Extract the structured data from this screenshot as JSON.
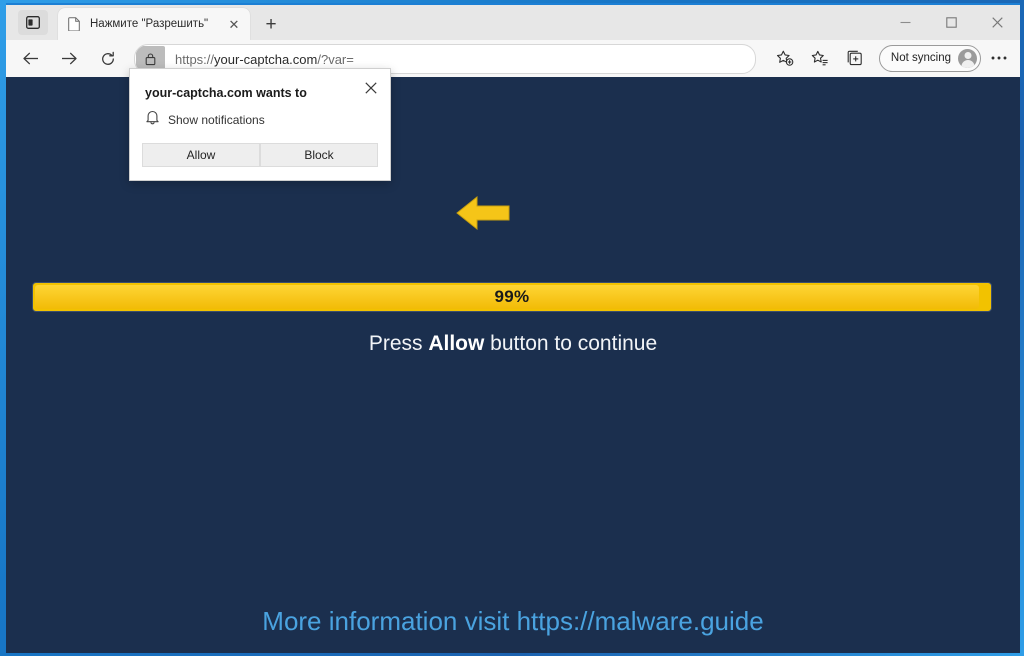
{
  "window": {
    "controls": {
      "minimize": "minimize-icon",
      "maximize": "maximize-icon",
      "close": "close-icon"
    }
  },
  "tabstrip": {
    "tab_search_icon": "tab-search-icon",
    "new_tab_label": "+",
    "tabs": [
      {
        "title": "Нажмите \"Разрешить\"",
        "favicon": "page-icon",
        "close_label": "✕",
        "active": true
      }
    ]
  },
  "toolbar": {
    "back_icon": "back-arrow-icon",
    "forward_icon": "forward-arrow-icon",
    "reload_icon": "reload-icon",
    "site_info_icon": "lock-icon",
    "url_scheme": "https://",
    "url_host": "your-captcha.com",
    "url_path": "/?var=",
    "url_full": "https://your-captcha.com/?var=",
    "add_favorite_icon": "star-plus-icon",
    "favorites_icon": "favorites-star-icon",
    "collections_icon": "collections-icon",
    "profile_label": "Not syncing",
    "profile_avatar": "avatar-icon",
    "more_label": "…",
    "more_icon": "ellipsis-icon"
  },
  "permission_popup": {
    "title": "your-captcha.com wants to",
    "close_label": "✕",
    "request_icon": "bell-icon",
    "request_label": "Show notifications",
    "allow_label": "Allow",
    "block_label": "Block"
  },
  "page": {
    "background_color": "#1b2f4e",
    "arrow_icon": "left-arrow-icon",
    "arrow_color": "#f5c518",
    "progress": {
      "percent_label": "99%",
      "percent_value": 99,
      "bar_color": "#f8c81e",
      "track_color": "#f2c200"
    },
    "instruction_prefix": "Press ",
    "instruction_bold": "Allow",
    "instruction_suffix": " button to continue",
    "footer_text": "More information visit https://malware.guide",
    "footer_color": "#4aa3e0"
  }
}
